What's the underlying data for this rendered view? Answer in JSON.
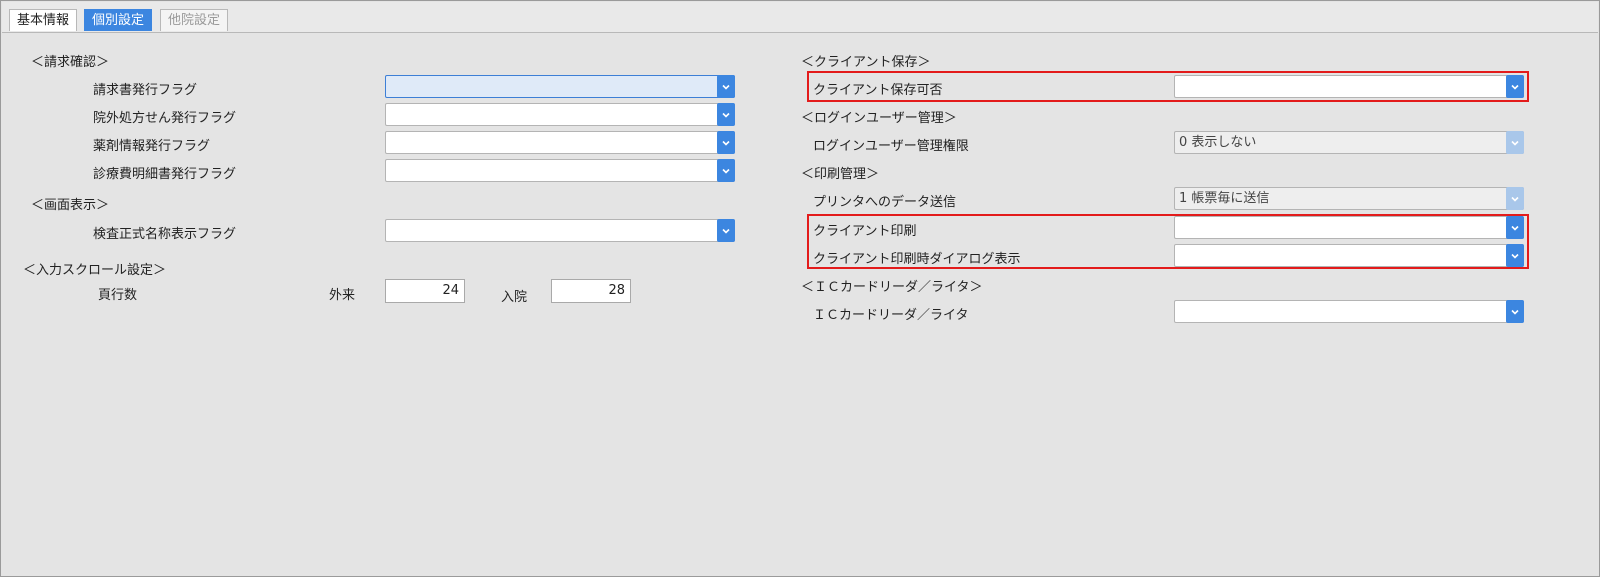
{
  "tabs": [
    {
      "label": "基本情報"
    },
    {
      "label": "個別設定"
    },
    {
      "label": "他院設定"
    }
  ],
  "left": {
    "billing": {
      "title": "＜請求確認＞",
      "rows": [
        {
          "label": "請求書発行フラグ",
          "value": ""
        },
        {
          "label": "院外処方せん発行フラグ",
          "value": ""
        },
        {
          "label": "薬剤情報発行フラグ",
          "value": ""
        },
        {
          "label": "診療費明細書発行フラグ",
          "value": ""
        }
      ]
    },
    "display": {
      "title": "＜画面表示＞",
      "rows": [
        {
          "label": "検査正式名称表示フラグ",
          "value": ""
        }
      ]
    },
    "scroll": {
      "title": "＜入力スクロール設定＞",
      "label": "頁行数",
      "outpatient_label": "外来",
      "outpatient_value": "24",
      "inpatient_label": "入院",
      "inpatient_value": "28"
    }
  },
  "right": {
    "client_save": {
      "title": "＜クライアント保存＞",
      "rows": [
        {
          "label": "クライアント保存可否",
          "value": ""
        }
      ]
    },
    "login": {
      "title": "＜ログインユーザー管理＞",
      "rows": [
        {
          "label": "ログインユーザー管理権限",
          "value": "0 表示しない"
        }
      ]
    },
    "print": {
      "title": "＜印刷管理＞",
      "rows": [
        {
          "label": "プリンタへのデータ送信",
          "value": "1 帳票毎に送信"
        },
        {
          "label": "クライアント印刷",
          "value": ""
        },
        {
          "label": "クライアント印刷時ダイアログ表示",
          "value": ""
        }
      ]
    },
    "ic": {
      "title": "＜ＩＣカードリーダ／ライタ＞",
      "rows": [
        {
          "label": "ＩＣカードリーダ／ライタ",
          "value": ""
        }
      ]
    }
  },
  "colors": {
    "accent": "#3c86e0",
    "highlight": "#e31b1b",
    "background": "#e4e4e4"
  }
}
